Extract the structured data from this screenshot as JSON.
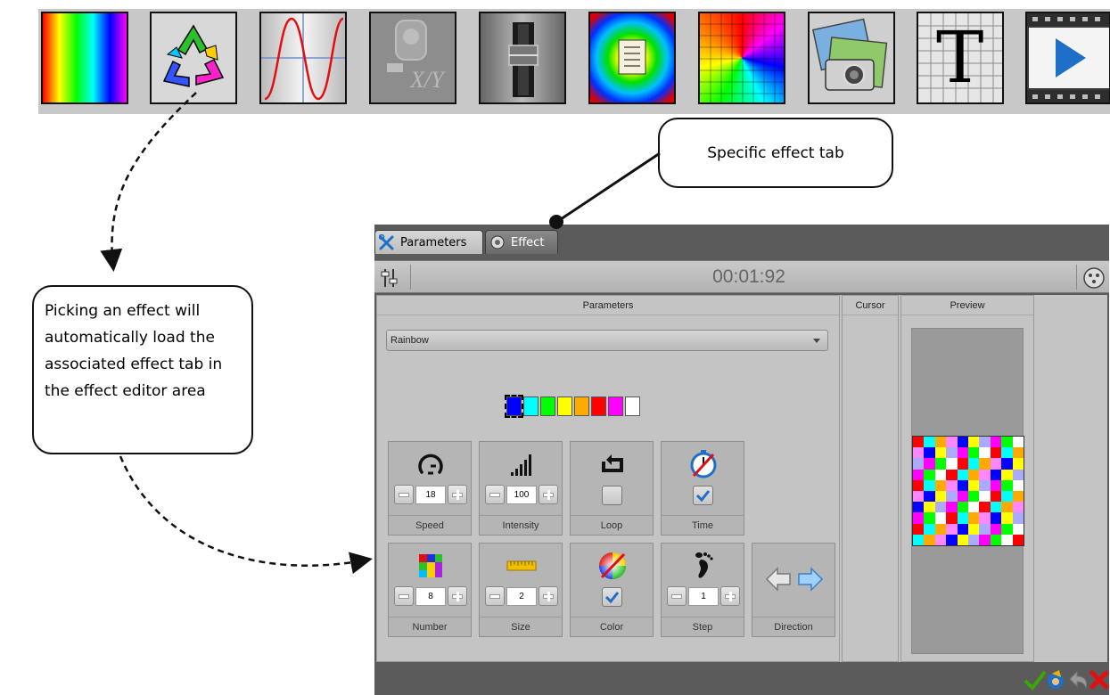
{
  "effect_toolbar": {
    "tiles": [
      {
        "name": "rainbow-effect-icon"
      },
      {
        "name": "recycle-effect-icon"
      },
      {
        "name": "sine-wave-effect-icon"
      },
      {
        "name": "xy-effect-icon"
      },
      {
        "name": "fader-effect-icon"
      },
      {
        "name": "concentric-effect-icon"
      },
      {
        "name": "spiral-effect-icon"
      },
      {
        "name": "picture-effect-icon"
      },
      {
        "name": "text-effect-icon"
      },
      {
        "name": "video-effect-icon"
      }
    ],
    "text_tile_letter": "T",
    "xy_tile_label": "X/Y"
  },
  "callouts": {
    "tab": "Specific effect tab",
    "pick": "Picking an effect will automatically load the associated effect tab in the effect editor area"
  },
  "editor": {
    "tabs": {
      "parameters": "Parameters",
      "effect": "Effect"
    },
    "time": "00:01:92",
    "panels": {
      "parameters": "Parameters",
      "cursor": "Cursor",
      "preview": "Preview"
    },
    "effect_select": "Rainbow",
    "swatch_colors": [
      "#0000ff",
      "#00ffff",
      "#00ff00",
      "#ffff00",
      "#ffaa00",
      "#ff0000",
      "#ff00ff",
      "#ffffff"
    ],
    "controls": {
      "speed": {
        "label": "Speed",
        "value": "18"
      },
      "intensity": {
        "label": "Intensity",
        "value": "100"
      },
      "loop": {
        "label": "Loop",
        "checked": false
      },
      "time": {
        "label": "Time",
        "checked": true
      },
      "number": {
        "label": "Number",
        "value": "8"
      },
      "size": {
        "label": "Size",
        "value": "2"
      },
      "color": {
        "label": "Color",
        "checked": true
      },
      "step": {
        "label": "Step",
        "value": "1"
      },
      "direction": {
        "label": "Direction"
      }
    },
    "preview_colors": [
      "#ff0000",
      "#ff00ff",
      "#0000ff",
      "#00ffff",
      "#00ff00",
      "#ffff00",
      "#ffaa00",
      "#ffffff",
      "#aaaaff",
      "#ff88ff"
    ],
    "footer_buttons": [
      "ok-check-icon",
      "wizard-icon",
      "undo-icon",
      "cancel-icon"
    ]
  },
  "colors": {
    "accent_green": "#3aa800",
    "cancel_red": "#e01010",
    "check_blue": "#1e6fc8"
  }
}
